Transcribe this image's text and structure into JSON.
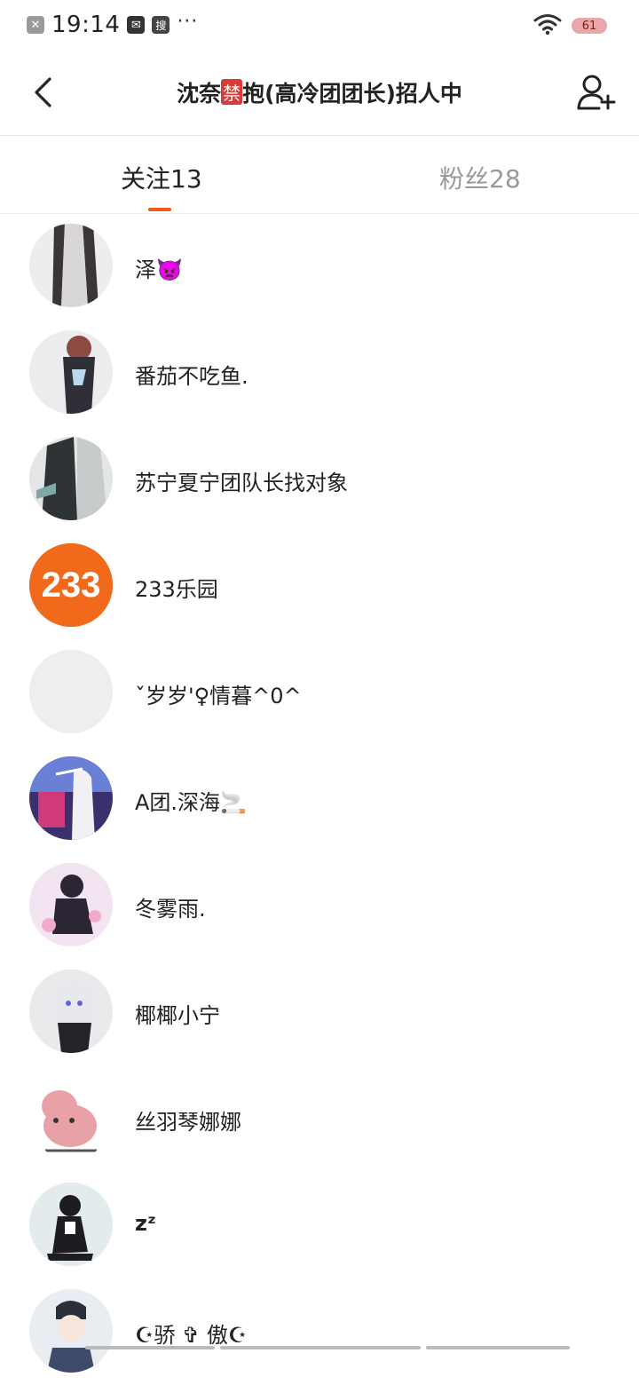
{
  "status_bar": {
    "time": "19:14",
    "search_badge": "搜",
    "more": "···",
    "battery": "61"
  },
  "header": {
    "title_prefix": "沈奈",
    "title_badge": "禁",
    "title_suffix": "抱(高冷团团长)招人中"
  },
  "tabs": {
    "following": "关注13",
    "fans": "粉丝28"
  },
  "users": [
    {
      "name": "泽👿"
    },
    {
      "name": "番茄不吃鱼."
    },
    {
      "name": "苏宁夏宁团队长找对象"
    },
    {
      "name": "233乐园",
      "avatar_text": "233"
    },
    {
      "name": "ˇ岁岁'♀情暮^0^"
    },
    {
      "name": "A团.深海🚬"
    },
    {
      "name": "冬雾雨."
    },
    {
      "name": "椰椰小宁"
    },
    {
      "name": "丝羽琴娜娜"
    },
    {
      "name": "zᶻ"
    },
    {
      "name": "☪骄 ✞ 傲☪"
    }
  ],
  "colors": {
    "accent": "#ee5a1e",
    "badge_red": "#d93b3b"
  }
}
